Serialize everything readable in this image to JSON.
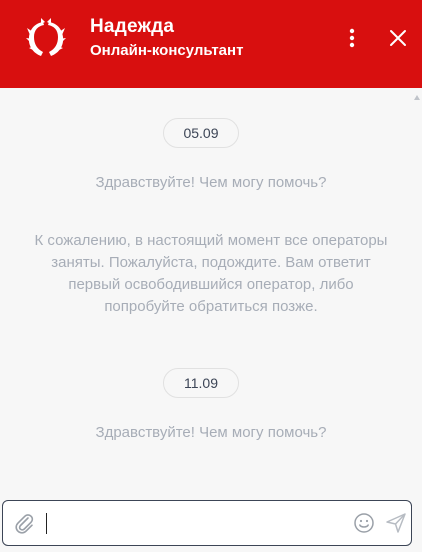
{
  "header": {
    "title": "Надежда",
    "subtitle": "Онлайн-консультант",
    "background_color": "#d80f0f",
    "logo_icon": "wreath-logo-icon",
    "menu_icon": "more-vertical-icon",
    "close_icon": "close-icon"
  },
  "conversation": {
    "groups": [
      {
        "date": "05.09",
        "messages": [
          "Здравствуйте! Чем могу помочь?",
          "К сожалению, в настоящий момент все операторы заняты. Пожалуйста, подождите. Вам ответит первый освободившийся оператор, либо попробуйте обратиться позже."
        ]
      },
      {
        "date": "11.09",
        "messages": [
          "Здравствуйте! Чем могу помочь?"
        ]
      }
    ]
  },
  "composer": {
    "value": "",
    "placeholder": "",
    "attach_icon": "paperclip-icon",
    "emoji_icon": "smiley-icon",
    "send_icon": "send-icon"
  },
  "colors": {
    "accent": "#d80f0f",
    "system_text": "#a7adb7",
    "date_text": "#3c4556"
  }
}
